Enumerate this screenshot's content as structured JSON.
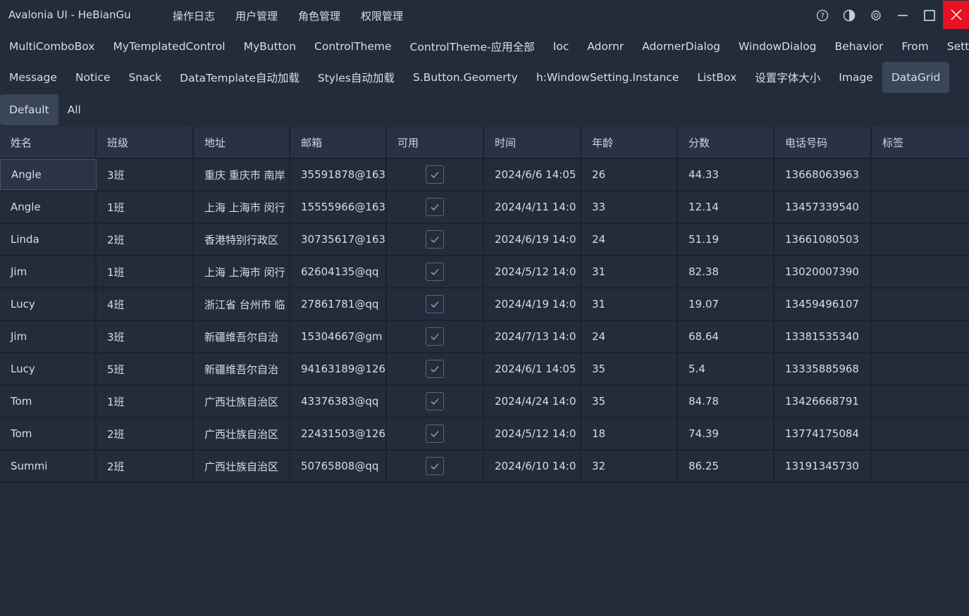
{
  "window": {
    "title": "Avalonia UI - HeBianGu",
    "menu": [
      "操作日志",
      "用户管理",
      "角色管理",
      "权限管理"
    ],
    "icons": [
      "help-icon",
      "theme-contrast-icon",
      "settings-gear-icon",
      "minimize-icon",
      "maximize-icon",
      "close-icon"
    ],
    "close_color": "#e81123"
  },
  "tabs_row1": [
    "MultiComboBox",
    "MyTemplatedControl",
    "MyButton",
    "ControlTheme",
    "ControlTheme-应用全部",
    "Ioc",
    "Adornr",
    "AdornerDialog",
    "WindowDialog",
    "Behavior",
    "From",
    "Setting"
  ],
  "tabs_row2": [
    "Message",
    "Notice",
    "Snack",
    "DataTemplate自动加载",
    "Styles自动加载",
    "S.Button.Geomerty",
    "h:WindowSetting.Instance",
    "ListBox",
    "设置字体大小",
    "Image",
    "DataGrid"
  ],
  "tabs_row2_active": "DataGrid",
  "subtabs": [
    "Default",
    "All"
  ],
  "subtabs_active": "Default",
  "grid": {
    "columns": [
      "姓名",
      "班级",
      "地址",
      "邮箱",
      "可用",
      "时间",
      "年龄",
      "分数",
      "电话号码",
      "标签"
    ],
    "rows": [
      {
        "name": "Angle",
        "class": "3班",
        "address": "重庆 重庆市 南岸",
        "email": "35591878@163",
        "enabled": true,
        "time": "2024/6/6 14:05",
        "age": "26",
        "score": "44.33",
        "phone": "13668063963",
        "tag": ""
      },
      {
        "name": "Angle",
        "class": "1班",
        "address": "上海 上海市 闵行",
        "email": "15555966@163",
        "enabled": true,
        "time": "2024/4/11 14:0",
        "age": "33",
        "score": "12.14",
        "phone": "13457339540",
        "tag": ""
      },
      {
        "name": "Linda",
        "class": "2班",
        "address": "香港特别行政区",
        "email": "30735617@163",
        "enabled": true,
        "time": "2024/6/19 14:0",
        "age": "24",
        "score": "51.19",
        "phone": "13661080503",
        "tag": ""
      },
      {
        "name": "Jim",
        "class": "1班",
        "address": "上海 上海市 闵行",
        "email": "62604135@qq",
        "enabled": true,
        "time": "2024/5/12 14:0",
        "age": "31",
        "score": "82.38",
        "phone": "13020007390",
        "tag": ""
      },
      {
        "name": "Lucy",
        "class": "4班",
        "address": "浙江省 台州市 临",
        "email": "27861781@qq",
        "enabled": true,
        "time": "2024/4/19 14:0",
        "age": "31",
        "score": "19.07",
        "phone": "13459496107",
        "tag": ""
      },
      {
        "name": "Jim",
        "class": "3班",
        "address": "新疆维吾尔自治",
        "email": "15304667@gm",
        "enabled": true,
        "time": "2024/7/13 14:0",
        "age": "24",
        "score": "68.64",
        "phone": "13381535340",
        "tag": ""
      },
      {
        "name": "Lucy",
        "class": "5班",
        "address": "新疆维吾尔自治",
        "email": "94163189@126",
        "enabled": true,
        "time": "2024/6/1 14:05",
        "age": "35",
        "score": "5.4",
        "phone": "13335885968",
        "tag": ""
      },
      {
        "name": "Tom",
        "class": "1班",
        "address": "广西壮族自治区",
        "email": "43376383@qq",
        "enabled": true,
        "time": "2024/4/24 14:0",
        "age": "35",
        "score": "84.78",
        "phone": "13426668791",
        "tag": ""
      },
      {
        "name": "Tom",
        "class": "2班",
        "address": "广西壮族自治区",
        "email": "22431503@126",
        "enabled": true,
        "time": "2024/5/12 14:0",
        "age": "18",
        "score": "74.39",
        "phone": "13774175084",
        "tag": ""
      },
      {
        "name": "Summi",
        "class": "2班",
        "address": "广西壮族自治区",
        "email": "50765808@qq",
        "enabled": true,
        "time": "2024/6/10 14:0",
        "age": "32",
        "score": "86.25",
        "phone": "13191345730",
        "tag": ""
      }
    ]
  }
}
